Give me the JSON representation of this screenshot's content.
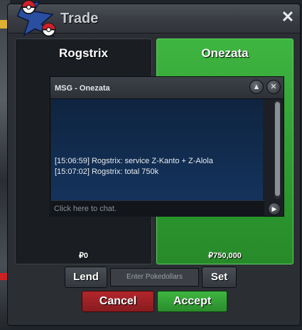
{
  "window": {
    "title": "Trade",
    "close_icon": "close-icon"
  },
  "left_player": {
    "name": "Rogstrix",
    "money": "₽0"
  },
  "right_player": {
    "name": "Onezata",
    "money": "₽750,000",
    "accent": "#3fb541"
  },
  "chat": {
    "title": "MSG - Onezata",
    "messages": [
      "[15:06:59] Rogstrix: service Z-Kanto + Z-Alola",
      "[15:07:02] Rogstrix: total 750k"
    ],
    "input_placeholder": "Click here to chat."
  },
  "controls": {
    "lend_label": "Lend",
    "money_placeholder": "Enter Pokedollars",
    "set_label": "Set",
    "cancel_label": "Cancel",
    "accept_label": "Accept",
    "cancel_color": "#b3262b",
    "accept_color": "#3fb541"
  }
}
